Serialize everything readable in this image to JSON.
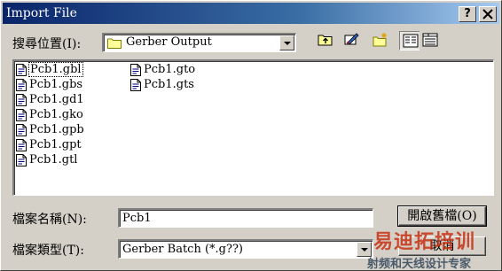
{
  "window": {
    "title": "Import File",
    "help_glyph": "?",
    "close_glyph": "✕"
  },
  "lookin": {
    "label": "搜尋位置(I):",
    "value": "Gerber Output",
    "icon": "folder-icon"
  },
  "toolbar": {
    "buttons": [
      "up-one-level-icon",
      "desktop-icon",
      "new-folder-icon",
      "list-view-icon",
      "details-view-icon"
    ]
  },
  "files": {
    "column1": [
      "Pcb1.gbl",
      "Pcb1.gbs",
      "Pcb1.gd1",
      "Pcb1.gko",
      "Pcb1.gpb",
      "Pcb1.gpt",
      "Pcb1.gtl"
    ],
    "column2": [
      "Pcb1.gto",
      "Pcb1.gts"
    ]
  },
  "filename": {
    "label": "檔案名稱(N):",
    "value": "Pcb1"
  },
  "filetype": {
    "label": "檔案類型(T):",
    "value": "Gerber Batch (*.g??)"
  },
  "buttons": {
    "open": "開啟舊檔(O)",
    "cancel": "取消"
  },
  "watermark": {
    "logo": "易迪拓培训",
    "tagline": "射频和天线设计专家",
    "colors": {
      "logo": "#c83214",
      "tagline": "#4a5a6a"
    }
  }
}
